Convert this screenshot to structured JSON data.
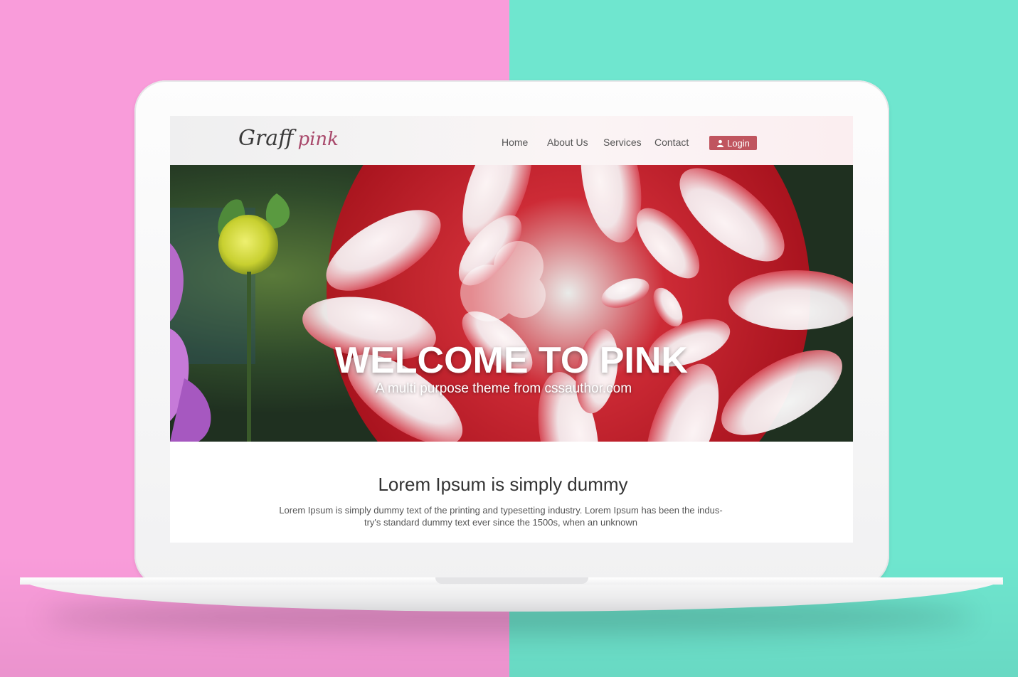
{
  "background": {
    "left_color": "#f99cda",
    "right_color": "#6fe6cf"
  },
  "site": {
    "logo": {
      "part1": "Graff",
      "part2": "pink"
    },
    "nav": [
      {
        "label": "Home"
      },
      {
        "label": "About Us"
      },
      {
        "label": "Services"
      },
      {
        "label": "Contact"
      }
    ],
    "login": {
      "label": "Login",
      "icon": "user-icon",
      "color": "#c0555f"
    },
    "hero": {
      "title": "WELCOME TO PINK",
      "subtitle": "A multi purpose theme from cssauthor.com"
    },
    "content": {
      "title": "Lorem Ipsum is simply dummy",
      "text_line1": "Lorem Ipsum is simply dummy text of the printing and typesetting industry. Lorem Ipsum has been the indus-",
      "text_line2": "try's standard dummy text ever since the 1500s, when an unknown"
    }
  }
}
